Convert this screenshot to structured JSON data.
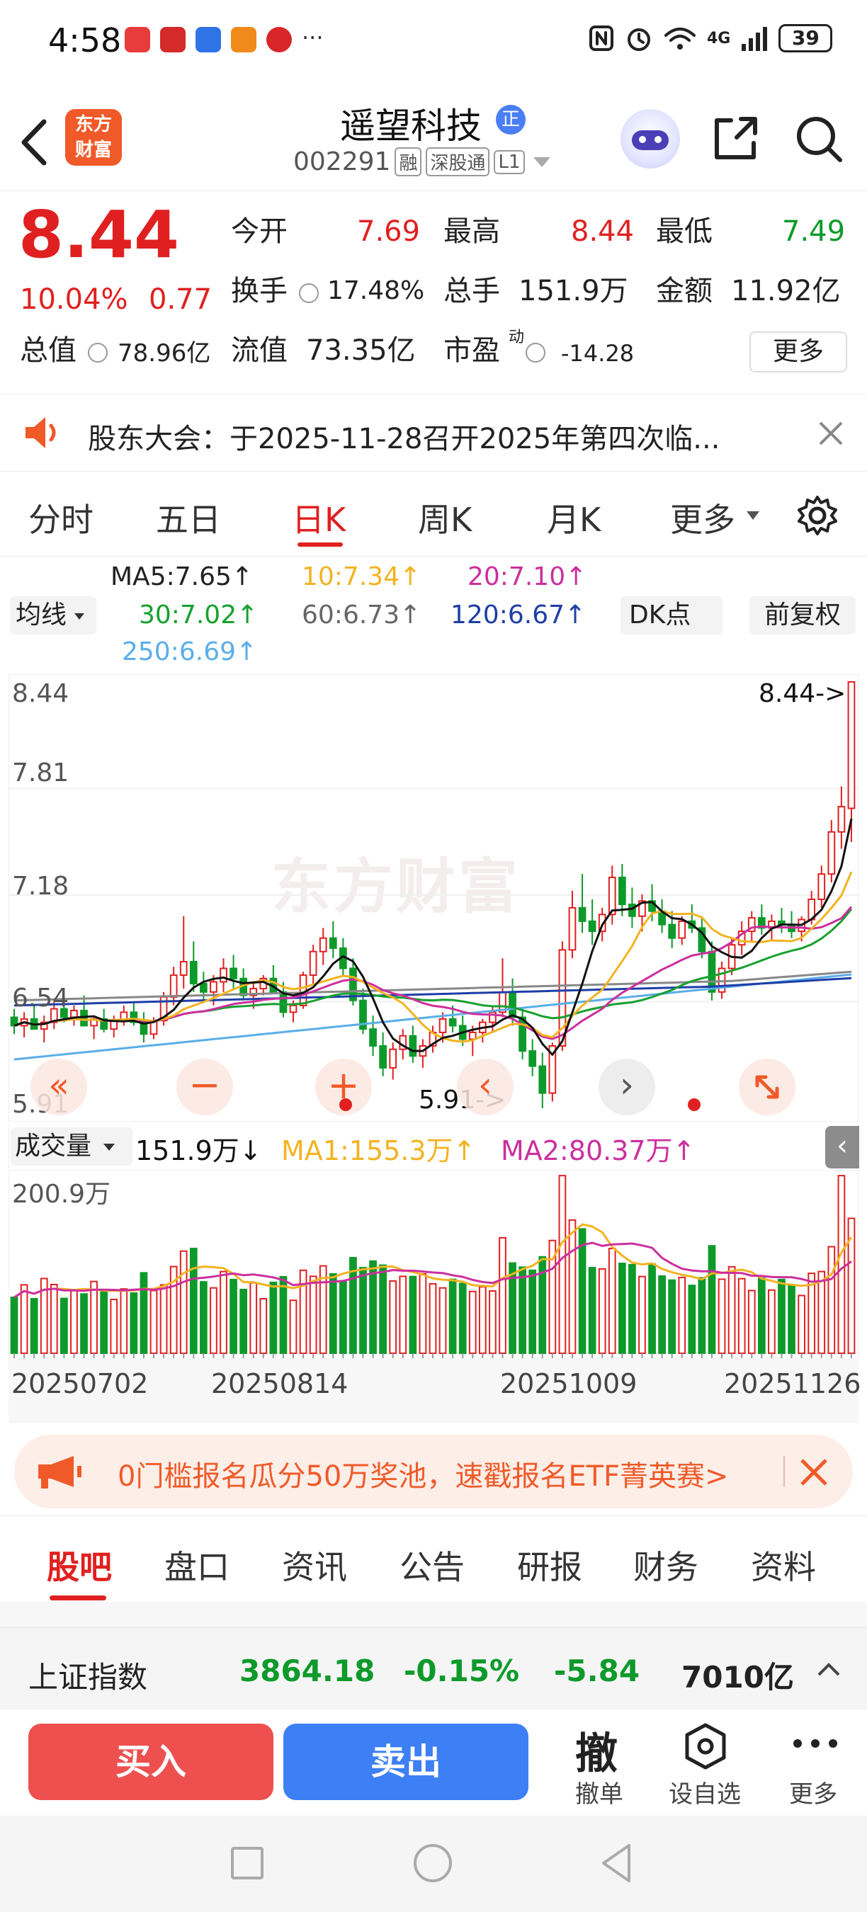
{
  "status_bar": {
    "time": "4:58",
    "more": "···",
    "network": "4G",
    "battery": "39"
  },
  "header": {
    "app_logo": "东方\n财富",
    "stock_name": "遥望科技",
    "badge": "正",
    "code": "002291",
    "tag_rong": "融",
    "tag_hk": "深股通",
    "tag_level": "L1"
  },
  "quote": {
    "price": "8.44",
    "change_pct": "10.04%",
    "change_amt": "0.77",
    "open_label": "今开",
    "open_value": "7.69",
    "high_label": "最高",
    "high_value": "8.44",
    "low_label": "最低",
    "low_value": "7.49",
    "turnover_label": "换手",
    "turnover_value": "17.48%",
    "volume_label": "总手",
    "volume_value": "151.9万",
    "amount_label": "金额",
    "amount_value": "11.92亿",
    "mktcap_label": "总值",
    "mktcap_value": "78.96亿",
    "float_label": "流值",
    "float_value": "73.35亿",
    "pe_label": "市盈",
    "pe_sup": "动",
    "pe_value": "-14.28",
    "more_button": "更多"
  },
  "notice": {
    "text": "股东大会：于2025-11-28召开2025年第四次临..."
  },
  "chart_tabs": [
    "分时",
    "五日",
    "日K",
    "周K",
    "月K",
    "更多"
  ],
  "active_tab_index": 2,
  "ma_legend": {
    "ma5": "MA5:7.65↑",
    "ma10": "10:7.34↑",
    "ma20": "20:7.10↑",
    "ma30": "30:7.02↑",
    "ma60": "60:6.73↑",
    "ma120": "120:6.67↑",
    "ma250": "250:6.69↑",
    "junxian": "均线",
    "dk_button": "DK点",
    "adjust_button": "前复权"
  },
  "price_axis": {
    "max": "8.44",
    "t1": "7.81",
    "t2": "7.18",
    "t3": "6.54",
    "min": "5.91",
    "max_marker": "8.44->",
    "min_marker": "5.91->"
  },
  "watermark": "东方财富",
  "volume_legend": {
    "selector": "成交量",
    "value": "151.9万↓",
    "ma1": "MA1:155.3万↑",
    "ma2": "MA2:80.37万↑",
    "max": "200.9万"
  },
  "dates": [
    "20250702",
    "20250814",
    "20251009",
    "20251126"
  ],
  "ad_banner": {
    "text": "0门槛报名瓜分50万奖池，速戳报名ETF菁英赛>"
  },
  "bottom_tabs": [
    "股吧",
    "盘口",
    "资讯",
    "公告",
    "研报",
    "财务",
    "资料"
  ],
  "index_bar": {
    "name": "上证指数",
    "value": "3864.18",
    "pct": "-0.15%",
    "change": "-5.84",
    "amount": "7010亿"
  },
  "actions": {
    "buy": "买入",
    "sell": "卖出",
    "cancel_icon": "撤",
    "cancel": "撤单",
    "watch": "设自选",
    "more": "更多"
  },
  "colors": {
    "up": "#e02020",
    "down": "#0d9a2a",
    "brand": "#f05a28",
    "sell_blue": "#3d7ff5",
    "buy_red": "#ee5050"
  },
  "chart_data": {
    "type": "candlestick",
    "note_series": [
      "MA5",
      "MA10",
      "MA20",
      "MA30",
      "MA60",
      "MA120",
      "MA250"
    ],
    "x_labels": [
      "20250702",
      "20250814",
      "20251009",
      "20251126"
    ],
    "ylim": [
      5.91,
      8.44
    ],
    "ohlc": [
      [
        6.45,
        6.5,
        6.35,
        6.4
      ],
      [
        6.4,
        6.48,
        6.33,
        6.44
      ],
      [
        6.44,
        6.52,
        6.4,
        6.38
      ],
      [
        6.38,
        6.46,
        6.3,
        6.42
      ],
      [
        6.42,
        6.55,
        6.38,
        6.5
      ],
      [
        6.5,
        6.56,
        6.42,
        6.45
      ],
      [
        6.45,
        6.52,
        6.4,
        6.49
      ],
      [
        6.49,
        6.58,
        6.44,
        6.4
      ],
      [
        6.4,
        6.46,
        6.32,
        6.44
      ],
      [
        6.44,
        6.5,
        6.36,
        6.38
      ],
      [
        6.38,
        6.46,
        6.33,
        6.43
      ],
      [
        6.43,
        6.52,
        6.4,
        6.48
      ],
      [
        6.48,
        6.54,
        6.4,
        6.42
      ],
      [
        6.42,
        6.48,
        6.3,
        6.35
      ],
      [
        6.35,
        6.45,
        6.32,
        6.43
      ],
      [
        6.43,
        6.6,
        6.4,
        6.57
      ],
      [
        6.57,
        6.75,
        6.52,
        6.7
      ],
      [
        6.7,
        7.05,
        6.62,
        6.78
      ],
      [
        6.78,
        6.9,
        6.6,
        6.65
      ],
      [
        6.65,
        6.72,
        6.55,
        6.6
      ],
      [
        6.6,
        6.7,
        6.52,
        6.66
      ],
      [
        6.66,
        6.8,
        6.6,
        6.74
      ],
      [
        6.74,
        6.82,
        6.62,
        6.68
      ],
      [
        6.68,
        6.74,
        6.55,
        6.58
      ],
      [
        6.58,
        6.66,
        6.5,
        6.62
      ],
      [
        6.62,
        6.7,
        6.58,
        6.68
      ],
      [
        6.68,
        6.76,
        6.62,
        6.6
      ],
      [
        6.6,
        6.66,
        6.45,
        6.48
      ],
      [
        6.48,
        6.55,
        6.42,
        6.52
      ],
      [
        6.52,
        6.72,
        6.5,
        6.7
      ],
      [
        6.7,
        6.88,
        6.65,
        6.84
      ],
      [
        6.84,
        6.98,
        6.76,
        6.92
      ],
      [
        6.92,
        7.02,
        6.8,
        6.86
      ],
      [
        6.86,
        6.92,
        6.7,
        6.74
      ],
      [
        6.74,
        6.8,
        6.52,
        6.55
      ],
      [
        6.55,
        6.62,
        6.35,
        6.38
      ],
      [
        6.38,
        6.46,
        6.22,
        6.28
      ],
      [
        6.28,
        6.36,
        6.1,
        6.15
      ],
      [
        6.15,
        6.3,
        6.08,
        6.26
      ],
      [
        6.26,
        6.38,
        6.2,
        6.34
      ],
      [
        6.34,
        6.4,
        6.18,
        6.22
      ],
      [
        6.22,
        6.32,
        6.15,
        6.28
      ],
      [
        6.28,
        6.4,
        6.24,
        6.36
      ],
      [
        6.36,
        6.48,
        6.3,
        6.44
      ],
      [
        6.44,
        6.52,
        6.36,
        6.4
      ],
      [
        6.4,
        6.46,
        6.28,
        6.32
      ],
      [
        6.32,
        6.4,
        6.22,
        6.36
      ],
      [
        6.36,
        6.44,
        6.3,
        6.42
      ],
      [
        6.42,
        6.52,
        6.36,
        6.48
      ],
      [
        6.48,
        6.8,
        6.45,
        6.6
      ],
      [
        6.6,
        6.68,
        6.4,
        6.45
      ],
      [
        6.45,
        6.5,
        6.2,
        6.25
      ],
      [
        6.25,
        6.32,
        6.1,
        6.16
      ],
      [
        6.16,
        6.24,
        5.91,
        6.0
      ],
      [
        6.0,
        6.3,
        5.95,
        6.28
      ],
      [
        6.28,
        6.9,
        6.25,
        6.85
      ],
      [
        6.85,
        7.2,
        6.8,
        7.1
      ],
      [
        7.1,
        7.3,
        6.95,
        7.02
      ],
      [
        7.02,
        7.15,
        6.88,
        6.96
      ],
      [
        6.96,
        7.1,
        6.9,
        7.06
      ],
      [
        7.06,
        7.35,
        7.0,
        7.28
      ],
      [
        7.28,
        7.36,
        7.05,
        7.12
      ],
      [
        7.12,
        7.22,
        6.98,
        7.05
      ],
      [
        7.05,
        7.18,
        6.96,
        7.14
      ],
      [
        7.14,
        7.24,
        7.02,
        7.08
      ],
      [
        7.08,
        7.15,
        6.95,
        7.0
      ],
      [
        7.0,
        7.08,
        6.86,
        6.92
      ],
      [
        6.92,
        7.05,
        6.88,
        7.02
      ],
      [
        7.02,
        7.12,
        6.95,
        6.98
      ],
      [
        6.98,
        7.05,
        6.8,
        6.84
      ],
      [
        6.84,
        6.9,
        6.55,
        6.6
      ],
      [
        6.6,
        6.78,
        6.56,
        6.74
      ],
      [
        6.74,
        6.92,
        6.7,
        6.88
      ],
      [
        6.88,
        7.02,
        6.82,
        6.96
      ],
      [
        6.96,
        7.08,
        6.9,
        7.04
      ],
      [
        7.04,
        7.12,
        6.94,
        6.98
      ],
      [
        6.98,
        7.06,
        6.9,
        7.02
      ],
      [
        7.02,
        7.1,
        6.95,
        7.0
      ],
      [
        7.0,
        7.08,
        6.92,
        6.96
      ],
      [
        6.96,
        7.05,
        6.9,
        7.03
      ],
      [
        7.03,
        7.2,
        7.0,
        7.15
      ],
      [
        7.15,
        7.35,
        7.1,
        7.3
      ],
      [
        7.3,
        7.62,
        7.25,
        7.55
      ],
      [
        7.55,
        7.82,
        7.45,
        7.7
      ],
      [
        7.69,
        8.44,
        7.49,
        8.44
      ]
    ]
  }
}
